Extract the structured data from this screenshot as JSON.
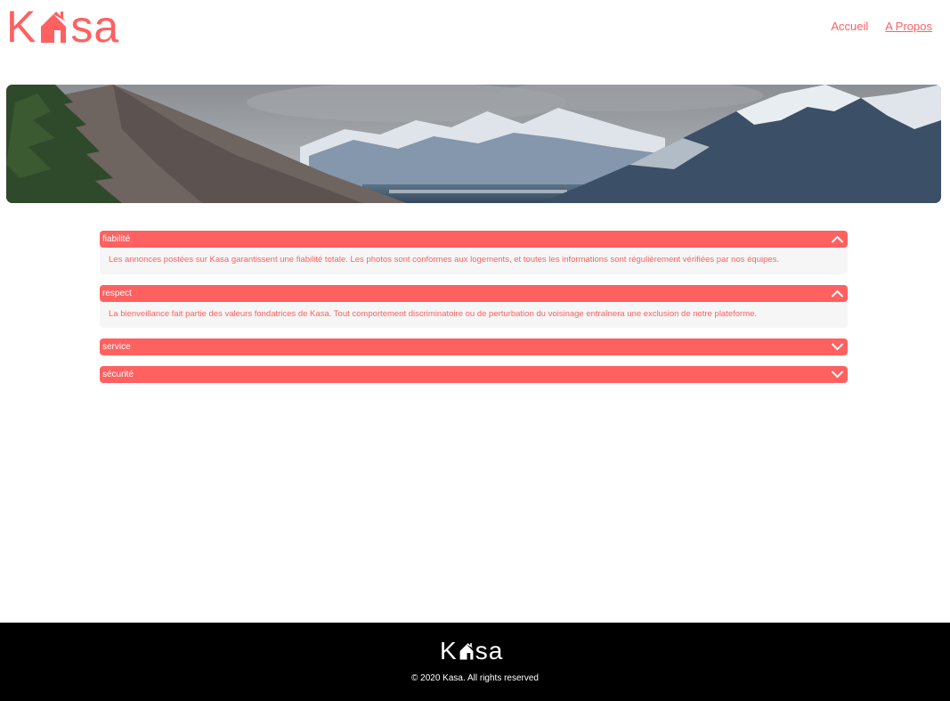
{
  "brand": {
    "logo_prefix": "K",
    "logo_suffix": "sa",
    "accent_color": "#FF6060"
  },
  "nav": {
    "items": [
      {
        "label": "Accueil",
        "active": false
      },
      {
        "label": "A Propos",
        "active": true
      }
    ]
  },
  "banner": {
    "image": "mountain-landscape"
  },
  "accordion": {
    "items": [
      {
        "title": "fiabilité",
        "expanded": true,
        "content": "Les annonces postées sur Kasa garantissent une fiabilité totale. Les photos sont conformes aux logements, et toutes les informations sont régulièrement vérifiées par nos équipes."
      },
      {
        "title": "respect",
        "expanded": true,
        "content": "La bienveillance fait partie des valeurs fondatrices de Kasa. Tout comportement discriminatoire ou de perturbation du voisinage entraînera une exclusion de notre plateforme."
      },
      {
        "title": "service",
        "expanded": false,
        "content": ""
      },
      {
        "title": "sécurité",
        "expanded": false,
        "content": ""
      }
    ]
  },
  "footer": {
    "logo_prefix": "K",
    "logo_suffix": "sa",
    "copyright": "© 2020 Kasa. All rights reserved"
  }
}
